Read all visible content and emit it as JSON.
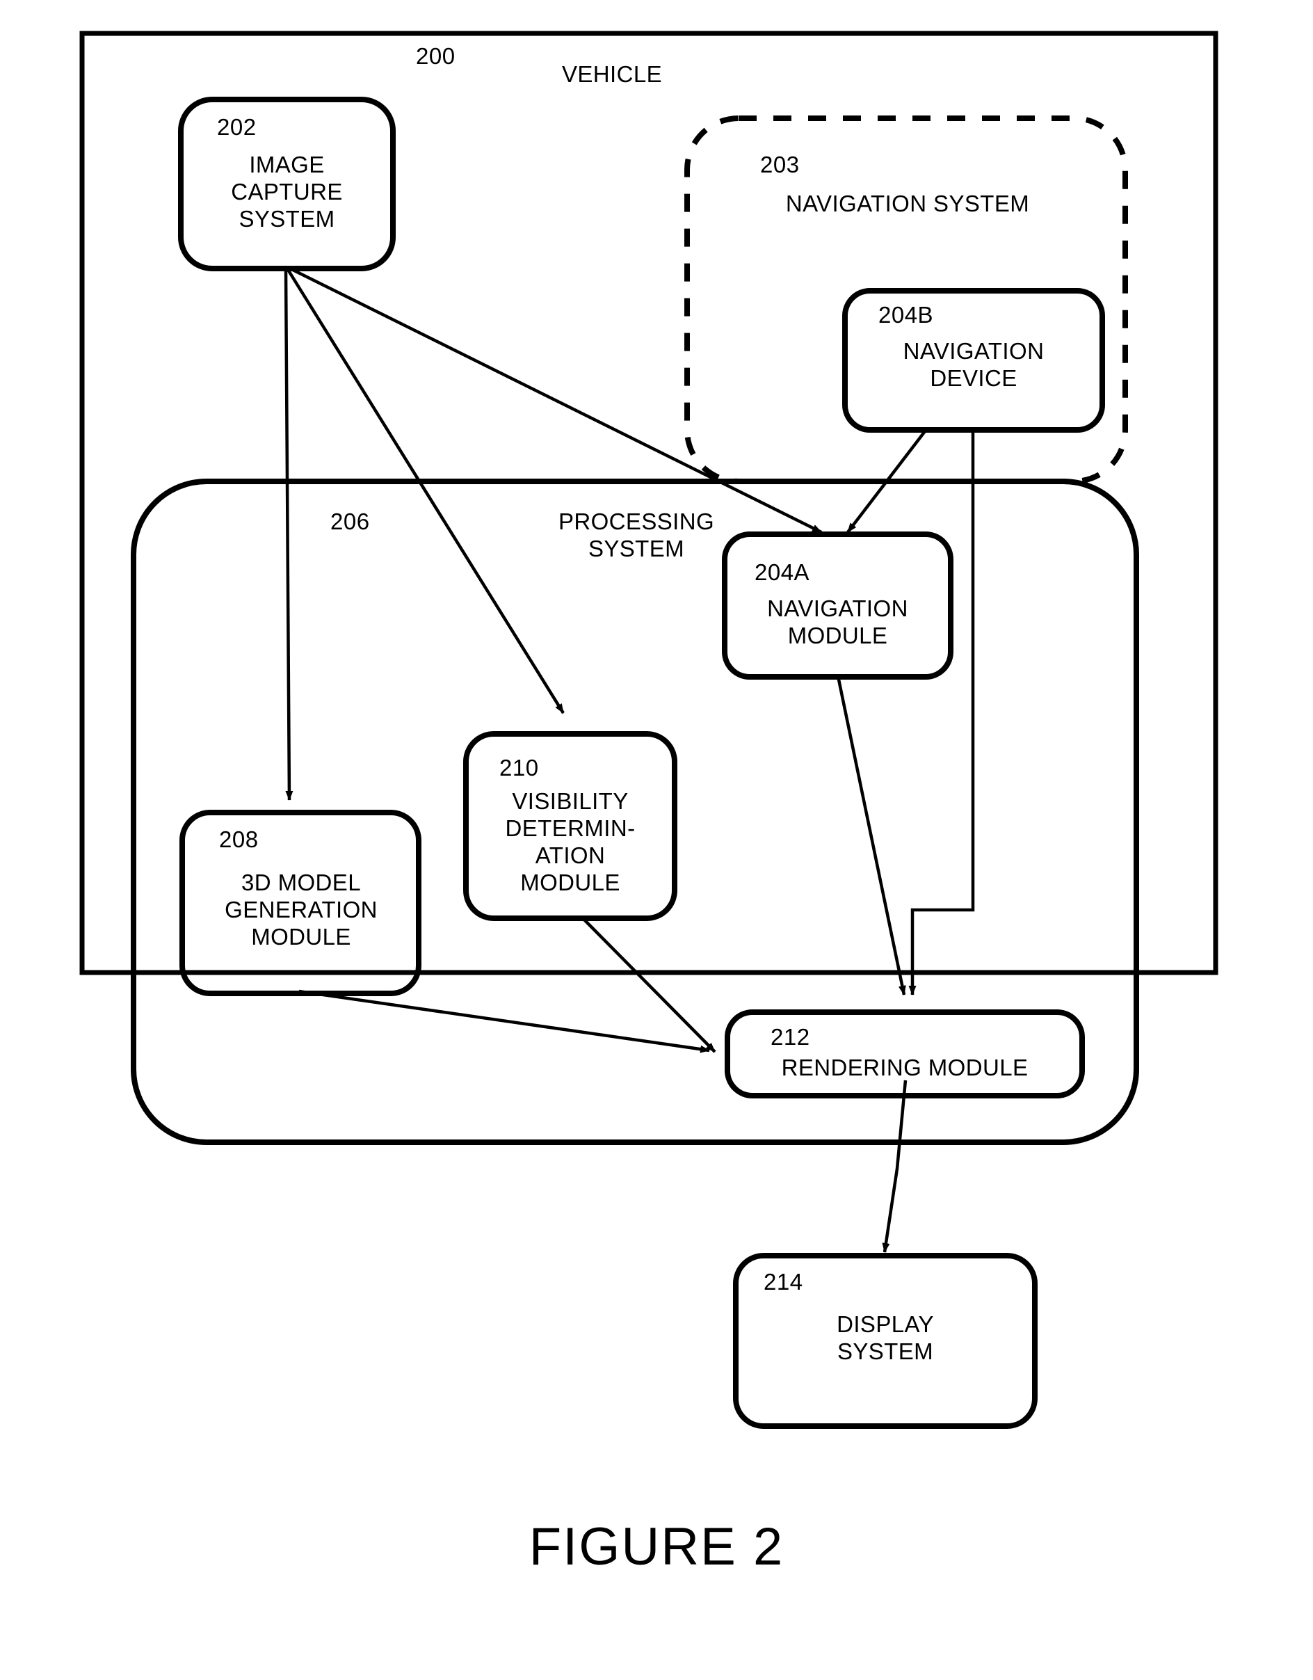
{
  "figure": {
    "caption": "FIGURE 2",
    "outer_frame_ref": "200",
    "outer_frame_label": "VEHICLE"
  },
  "groups": [
    {
      "id": "navigation-system",
      "ref": "203",
      "label": "NAVIGATION SYSTEM",
      "border": "dashed"
    },
    {
      "id": "processing-system",
      "ref": "206",
      "label": "PROCESSING\nSYSTEM",
      "border": "solid"
    }
  ],
  "nodes": [
    {
      "id": "image-capture-system",
      "ref": "202",
      "label": "IMAGE\nCAPTURE\nSYSTEM"
    },
    {
      "id": "navigation-device",
      "ref": "204B",
      "label": "NAVIGATION\nDEVICE"
    },
    {
      "id": "navigation-module",
      "ref": "204A",
      "label": "NAVIGATION\nMODULE"
    },
    {
      "id": "visibility-determination-module",
      "ref": "210",
      "label": "VISIBILITY\nDETERMIN-\nATION\nMODULE"
    },
    {
      "id": "three-d-model-generation-module",
      "ref": "208",
      "label": "3D MODEL\nGENERATION\nMODULE"
    },
    {
      "id": "rendering-module",
      "ref": "212",
      "label": "RENDERING MODULE"
    },
    {
      "id": "display-system",
      "ref": "214",
      "label": "DISPLAY\nSYSTEM"
    }
  ],
  "edges": [
    {
      "from": "202",
      "to": "208",
      "kind": "arrow"
    },
    {
      "from": "202",
      "to": "210",
      "kind": "arrow"
    },
    {
      "from": "202",
      "to": "204A",
      "kind": "arrow"
    },
    {
      "from": "204B",
      "to": "204A",
      "kind": "arrow"
    },
    {
      "from": "204B",
      "to": "212",
      "kind": "elbow-arrow"
    },
    {
      "from": "204A",
      "to": "212",
      "kind": "arrow"
    },
    {
      "from": "208",
      "to": "212",
      "kind": "arrow"
    },
    {
      "from": "210",
      "to": "212",
      "kind": "arrow"
    },
    {
      "from": "212",
      "to": "214",
      "kind": "arrow"
    }
  ],
  "style": {
    "ink": "#000000",
    "paper": "#ffffff"
  }
}
